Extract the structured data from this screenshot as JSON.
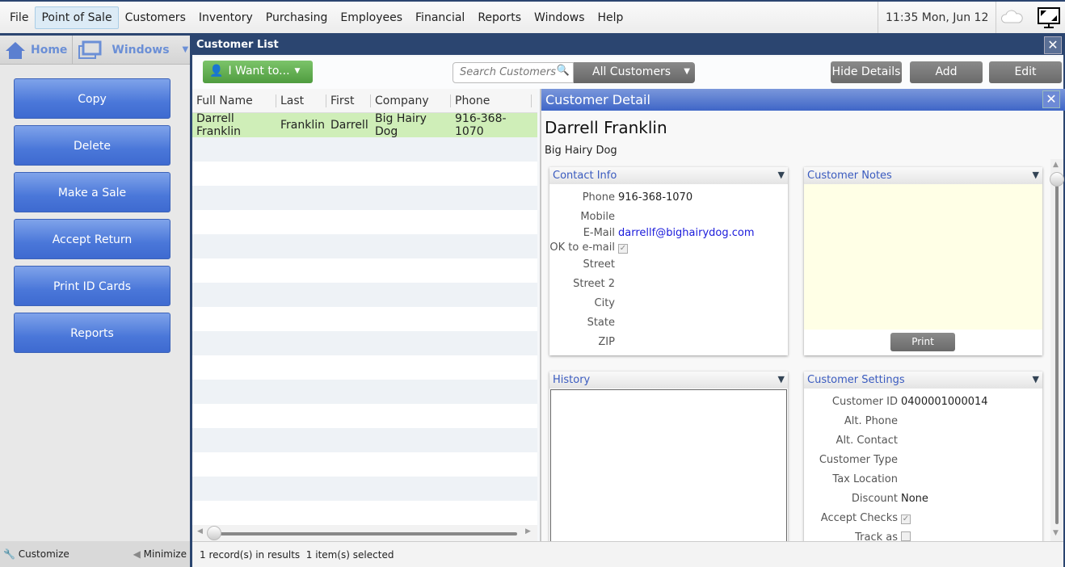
{
  "menu": [
    "File",
    "Point of Sale",
    "Customers",
    "Inventory",
    "Purchasing",
    "Employees",
    "Financial",
    "Reports",
    "Windows",
    "Help"
  ],
  "clock": "11:35 Mon, Jun 12",
  "sidebar": {
    "home": "Home",
    "windows": "Windows",
    "buttons": [
      "Copy",
      "Delete",
      "Make a Sale",
      "Accept Return",
      "Print ID Cards",
      "Reports"
    ],
    "customize": "Customize",
    "minimize": "Minimize"
  },
  "window": {
    "title": "Customer List",
    "close": "✕"
  },
  "toolbar": {
    "i_want": "I Want to...",
    "search_placeholder": "Search Customers",
    "filter": "All Customers",
    "hide_details": "Hide Details",
    "add": "Add",
    "edit": "Edit"
  },
  "grid": {
    "columns": [
      "Full Name",
      "Last",
      "First",
      "Company",
      "Phone"
    ],
    "rows": [
      [
        "Darrell Franklin",
        "Franklin",
        "Darrell",
        "Big Hairy Dog",
        "916-368-1070"
      ]
    ]
  },
  "detail": {
    "title": "Customer Detail",
    "name": "Darrell Franklin",
    "company": "Big Hairy Dog",
    "contact": {
      "title": "Contact Info",
      "fields": [
        [
          "Phone",
          "916-368-1070"
        ],
        [
          "Mobile",
          ""
        ],
        [
          "E-Mail",
          "darrellf@bighairydog.com"
        ],
        [
          "OK to e-mail",
          "checkbox"
        ],
        [
          "Street",
          ""
        ],
        [
          "Street 2",
          ""
        ],
        [
          "City",
          ""
        ],
        [
          "State",
          ""
        ],
        [
          "ZIP",
          ""
        ]
      ]
    },
    "notes": {
      "title": "Customer Notes",
      "print": "Print"
    },
    "history": {
      "title": "History"
    },
    "settings": {
      "title": "Customer Settings",
      "fields": [
        [
          "Customer ID",
          "0400001000014"
        ],
        [
          "Alt. Phone",
          ""
        ],
        [
          "Alt. Contact",
          ""
        ],
        [
          "Customer Type",
          ""
        ],
        [
          "Tax Location",
          ""
        ],
        [
          "Discount",
          "None"
        ],
        [
          "Accept Checks",
          "checkbox"
        ],
        [
          "Track as Company",
          "checkbox"
        ]
      ]
    }
  },
  "status": "1 record(s) in results  1 item(s) selected",
  "colors": {
    "navy": "#2b4570",
    "button_blue": "#4a77d9",
    "selected_row": "#cfeeb8",
    "notes_bg": "#ffffe6"
  }
}
